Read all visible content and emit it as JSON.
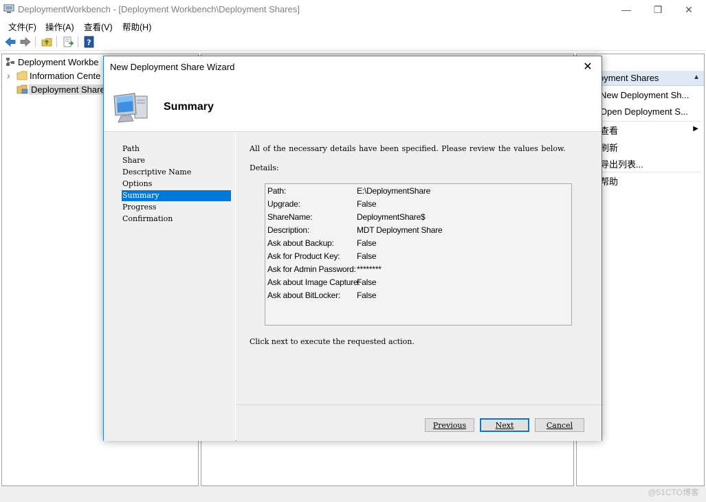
{
  "window": {
    "title": "DeploymentWorkbench - [Deployment Workbench\\Deployment Shares]",
    "minimize_glyph": "—",
    "maximize_glyph": "❐",
    "close_glyph": "✕"
  },
  "menu": {
    "file": "文件(F)",
    "action": "操作(A)",
    "view": "查看(V)",
    "help": "帮助(H)"
  },
  "toolbar": {
    "icons": [
      "back-arrow-icon",
      "forward-arrow-icon",
      "up-folder-icon",
      "export-list-icon",
      "help-icon"
    ]
  },
  "tree": {
    "root": "Deployment Workbe",
    "items": [
      {
        "label": "Information Cente",
        "expander": "›"
      },
      {
        "label": "Deployment Share"
      }
    ]
  },
  "actions": {
    "header": "oyment Shares",
    "items": [
      {
        "label": "New Deployment Sh..."
      },
      {
        "label": "Open Deployment S..."
      },
      {
        "label": "查看",
        "submenu_glyph": "▶"
      },
      {
        "label": "刷新"
      },
      {
        "label": "导出列表..."
      },
      {
        "label": "帮助"
      }
    ],
    "collapse_glyph": "▲"
  },
  "wizard": {
    "title": "New Deployment Share Wizard",
    "close_glyph": "✕",
    "page_title": "Summary",
    "steps": [
      "Path",
      "Share",
      "Descriptive Name",
      "Options",
      "Summary",
      "Progress",
      "Confirmation"
    ],
    "active_step": "Summary",
    "intro": "All of the necessary details have been specified.  Please review the values below.",
    "details_label": "Details:",
    "details": [
      {
        "key": "Path:",
        "value": "E:\\DeploymentShare"
      },
      {
        "key": "Upgrade:",
        "value": "False"
      },
      {
        "key": "ShareName:",
        "value": "DeploymentShare$"
      },
      {
        "key": "Description:",
        "value": "MDT Deployment Share"
      },
      {
        "key": "Ask about Backup:",
        "value": "False"
      },
      {
        "key": "Ask for Product Key:",
        "value": "False"
      },
      {
        "key": "Ask for Admin Password:",
        "value": "********"
      },
      {
        "key": "Ask about Image Capture:",
        "value": "False"
      },
      {
        "key": "Ask about BitLocker:",
        "value": "False"
      }
    ],
    "footer_note": "Click next to execute the requested action.",
    "buttons": {
      "previous": "Previous",
      "next": "Next",
      "cancel": "Cancel"
    }
  },
  "watermark": "@51CTO博客",
  "colors": {
    "selection": "#0078d7",
    "dialog_border": "#1883d7",
    "actions_header": "#dfe8f5"
  }
}
